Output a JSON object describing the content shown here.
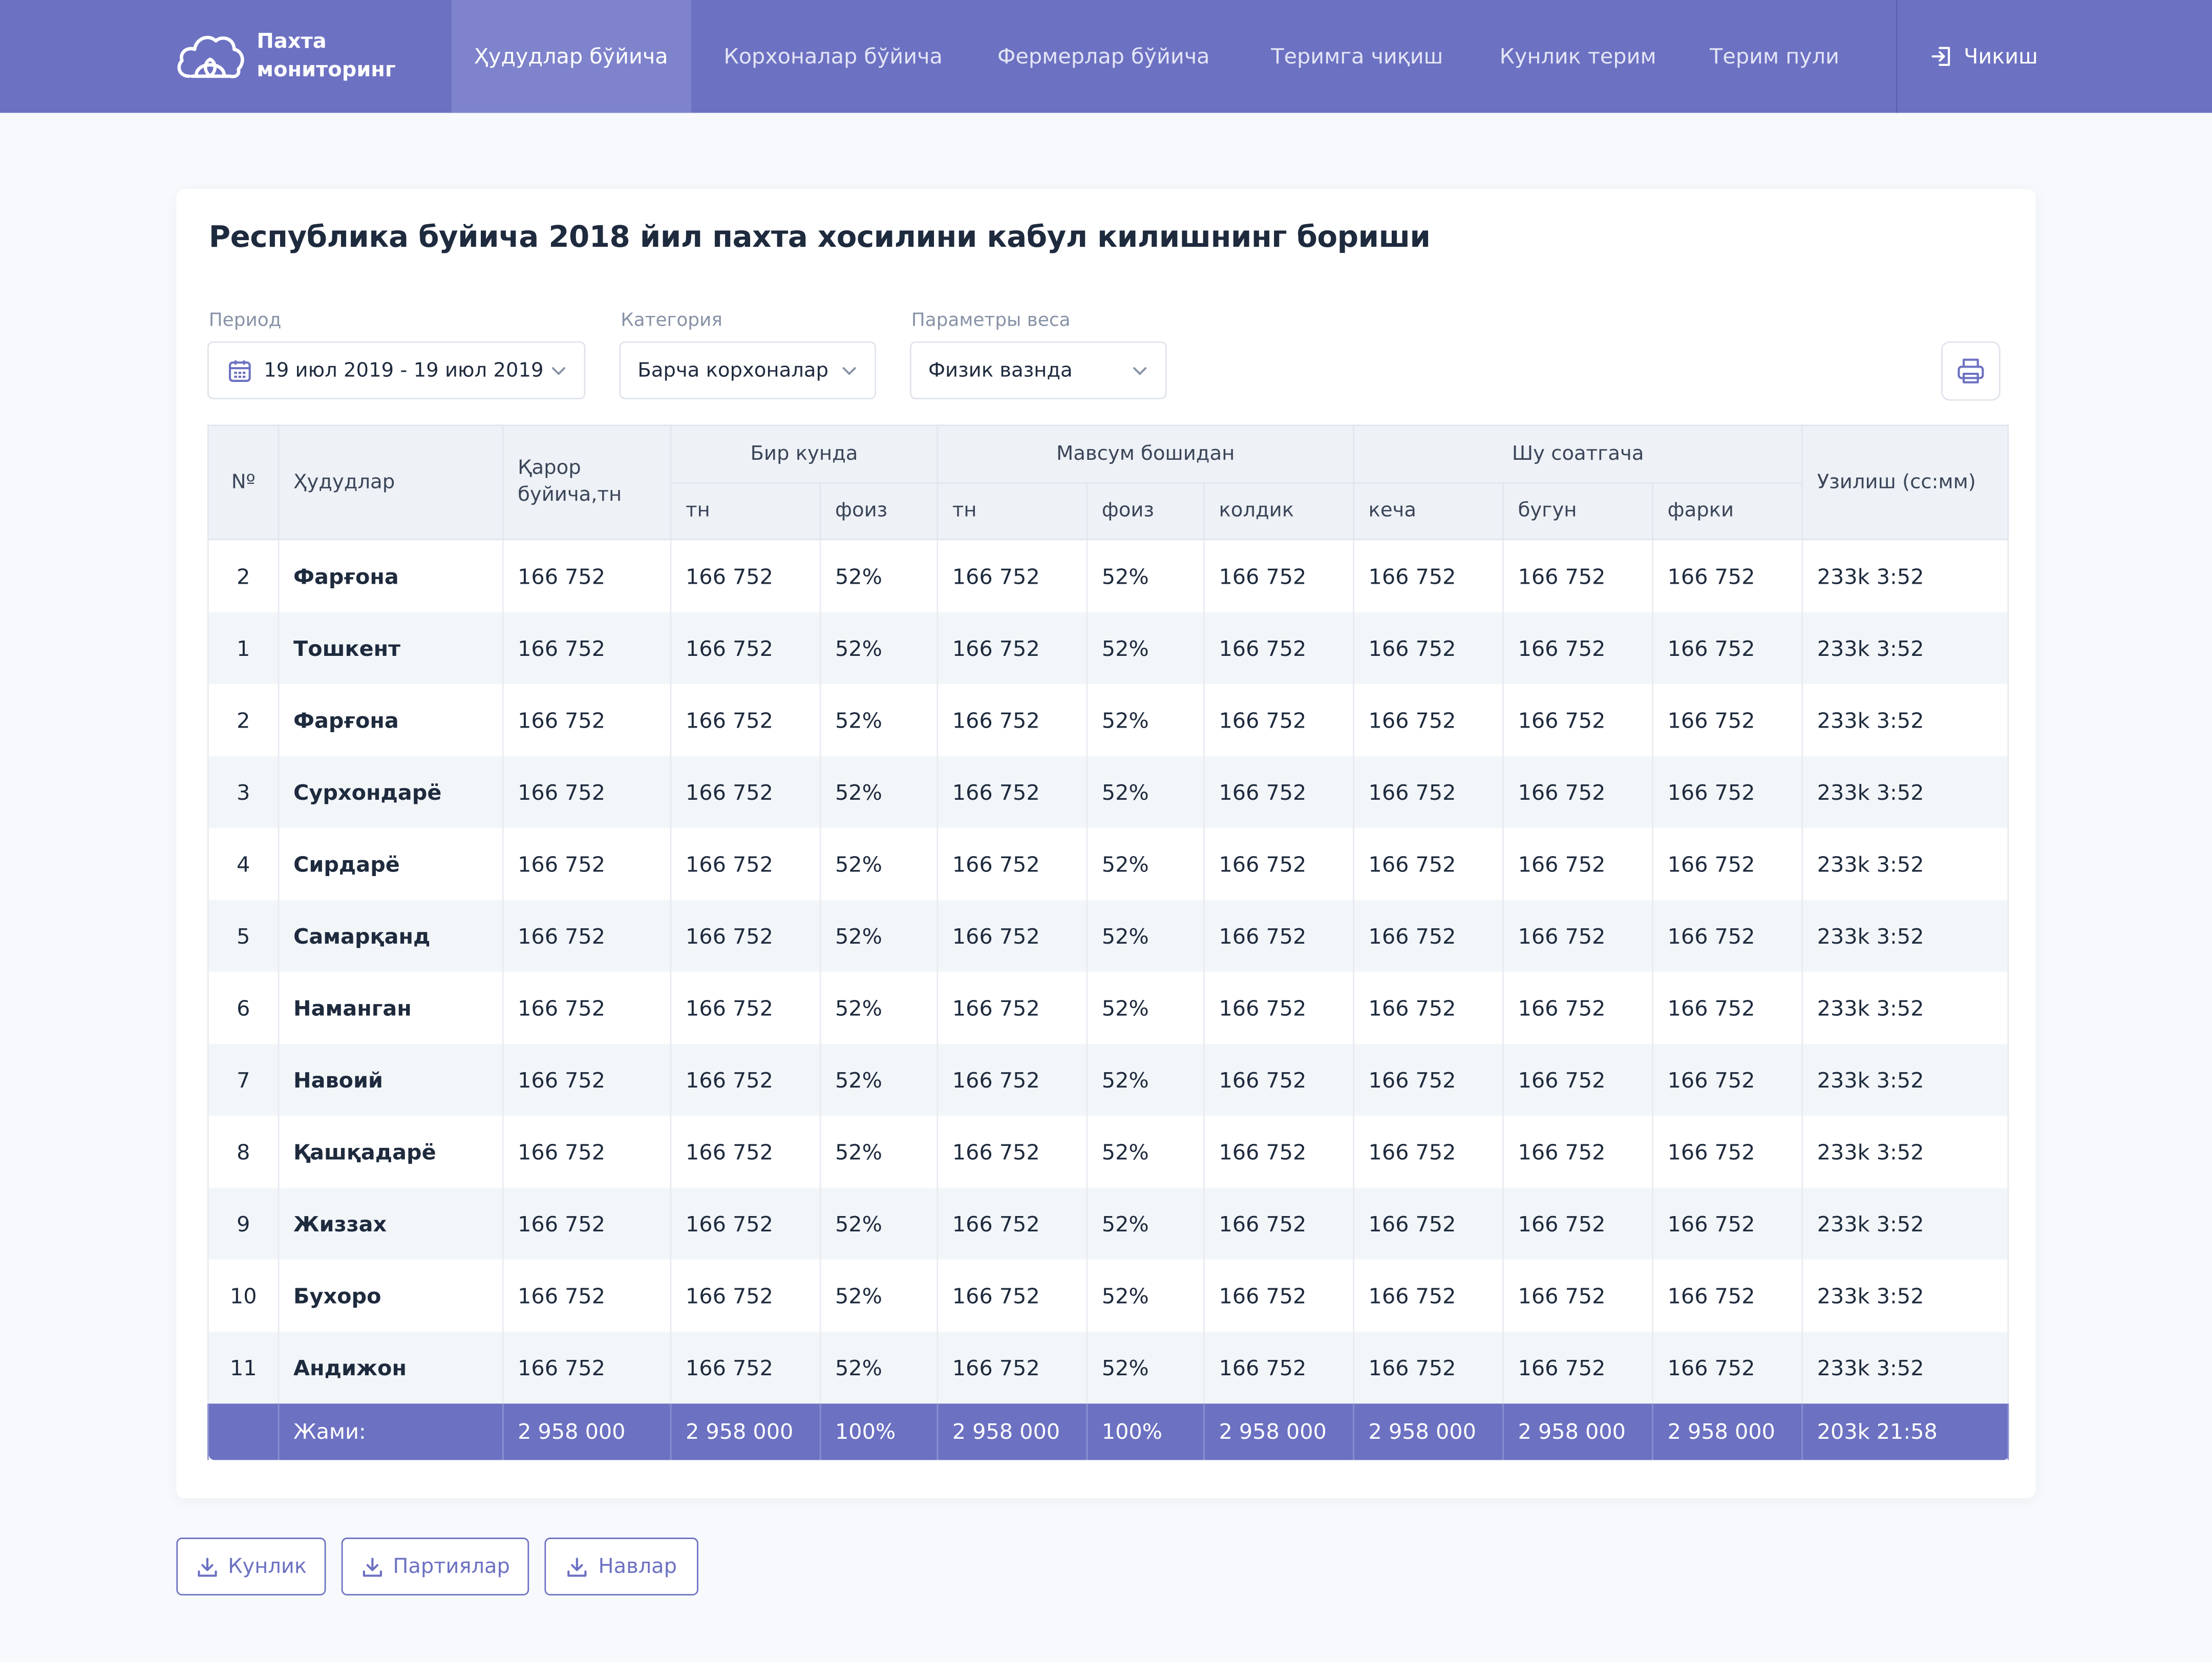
{
  "brand": {
    "line1": "Пахта",
    "line2": "мониторинг",
    "icon": "cotton-logo-icon"
  },
  "nav": {
    "items": [
      {
        "label": "Ҳудудлар бўйича",
        "active": true
      },
      {
        "label": "Корхоналар бўйича",
        "active": false
      },
      {
        "label": "Фермерлар бўйича",
        "active": false
      },
      {
        "label": "Теримга чиқиш",
        "active": false
      },
      {
        "label": "Кунлик терим",
        "active": false
      },
      {
        "label": "Терим пули",
        "active": false
      }
    ],
    "logout": "Чикиш"
  },
  "page": {
    "title": "Республика буйича 2018 йил пахта хосилини кабул килишнинг бориши"
  },
  "filters": {
    "period": {
      "label": "Период",
      "value": "19 июл 2019 - 19 июл 2019"
    },
    "category": {
      "label": "Категория",
      "value": "Барча корхоналар"
    },
    "weight": {
      "label": "Параметры веса",
      "value": "Физик вазнда"
    }
  },
  "table": {
    "headers": {
      "no": "Nº",
      "region": "Ҳудудлар",
      "plan": "Қарор буйича,тн",
      "day": "Бир кунда",
      "season": "Мавсум бошидан",
      "hour": "Шу соатгача",
      "gap": "Узилиш (cc:мм)",
      "day_tn": "тн",
      "day_pct": "фоиз",
      "season_tn": "тн",
      "season_pct": "фоиз",
      "season_rest": "колдик",
      "hour_yesterday": "кеча",
      "hour_today": "бугун",
      "hour_diff": "фарки"
    },
    "rows": [
      {
        "no": "2",
        "region": "Фарғона",
        "plan": "166 752",
        "day_tn": "166 752",
        "day_pct": "52%",
        "season_tn": "166 752",
        "season_pct": "52%",
        "season_rest": "166 752",
        "yesterday": "166 752",
        "today": "166 752",
        "diff": "166 752",
        "gap": "233k 3:52"
      },
      {
        "no": "1",
        "region": "Тошкент",
        "plan": "166 752",
        "day_tn": "166 752",
        "day_pct": "52%",
        "season_tn": "166 752",
        "season_pct": "52%",
        "season_rest": "166 752",
        "yesterday": "166 752",
        "today": "166 752",
        "diff": "166 752",
        "gap": "233k 3:52"
      },
      {
        "no": "2",
        "region": "Фарғона",
        "plan": "166 752",
        "day_tn": "166 752",
        "day_pct": "52%",
        "season_tn": "166 752",
        "season_pct": "52%",
        "season_rest": "166 752",
        "yesterday": "166 752",
        "today": "166 752",
        "diff": "166 752",
        "gap": "233k 3:52"
      },
      {
        "no": "3",
        "region": "Сурхондарё",
        "plan": "166 752",
        "day_tn": "166 752",
        "day_pct": "52%",
        "season_tn": "166 752",
        "season_pct": "52%",
        "season_rest": "166 752",
        "yesterday": "166 752",
        "today": "166 752",
        "diff": "166 752",
        "gap": "233k 3:52"
      },
      {
        "no": "4",
        "region": "Сирдарё",
        "plan": "166 752",
        "day_tn": "166 752",
        "day_pct": "52%",
        "season_tn": "166 752",
        "season_pct": "52%",
        "season_rest": "166 752",
        "yesterday": "166 752",
        "today": "166 752",
        "diff": "166 752",
        "gap": "233k 3:52"
      },
      {
        "no": "5",
        "region": "Самарқанд",
        "plan": "166 752",
        "day_tn": "166 752",
        "day_pct": "52%",
        "season_tn": "166 752",
        "season_pct": "52%",
        "season_rest": "166 752",
        "yesterday": "166 752",
        "today": "166 752",
        "diff": "166 752",
        "gap": "233k 3:52"
      },
      {
        "no": "6",
        "region": "Наманган",
        "plan": "166 752",
        "day_tn": "166 752",
        "day_pct": "52%",
        "season_tn": "166 752",
        "season_pct": "52%",
        "season_rest": "166 752",
        "yesterday": "166 752",
        "today": "166 752",
        "diff": "166 752",
        "gap": "233k 3:52"
      },
      {
        "no": "7",
        "region": "Навоий",
        "plan": "166 752",
        "day_tn": "166 752",
        "day_pct": "52%",
        "season_tn": "166 752",
        "season_pct": "52%",
        "season_rest": "166 752",
        "yesterday": "166 752",
        "today": "166 752",
        "diff": "166 752",
        "gap": "233k 3:52"
      },
      {
        "no": "8",
        "region": "Қашқадарё",
        "plan": "166 752",
        "day_tn": "166 752",
        "day_pct": "52%",
        "season_tn": "166 752",
        "season_pct": "52%",
        "season_rest": "166 752",
        "yesterday": "166 752",
        "today": "166 752",
        "diff": "166 752",
        "gap": "233k 3:52"
      },
      {
        "no": "9",
        "region": "Жиззах",
        "plan": "166 752",
        "day_tn": "166 752",
        "day_pct": "52%",
        "season_tn": "166 752",
        "season_pct": "52%",
        "season_rest": "166 752",
        "yesterday": "166 752",
        "today": "166 752",
        "diff": "166 752",
        "gap": "233k 3:52"
      },
      {
        "no": "10",
        "region": "Бухоро",
        "plan": "166 752",
        "day_tn": "166 752",
        "day_pct": "52%",
        "season_tn": "166 752",
        "season_pct": "52%",
        "season_rest": "166 752",
        "yesterday": "166 752",
        "today": "166 752",
        "diff": "166 752",
        "gap": "233k 3:52"
      },
      {
        "no": "11",
        "region": "Андижон",
        "plan": "166 752",
        "day_tn": "166 752",
        "day_pct": "52%",
        "season_tn": "166 752",
        "season_pct": "52%",
        "season_rest": "166 752",
        "yesterday": "166 752",
        "today": "166 752",
        "diff": "166 752",
        "gap": "233k 3:52"
      }
    ],
    "total": {
      "label": "Жами:",
      "plan": "2 958 000",
      "day_tn": "2 958 000",
      "day_pct": "100%",
      "season_tn": "2 958 000",
      "season_pct": "100%",
      "season_rest": "2 958 000",
      "yesterday": "2 958 000",
      "today": "2 958 000",
      "diff": "2 958 000",
      "gap": "203k 21:58"
    }
  },
  "downloads": [
    {
      "label": "Кунлик",
      "icon": "download-icon"
    },
    {
      "label": "Партиялар",
      "icon": "download-icon"
    },
    {
      "label": "Навлар",
      "icon": "download-icon"
    }
  ],
  "colors": {
    "primary": "#6c71c2",
    "nav_active": "#7e83cc",
    "background": "#f7f9fc",
    "text": "#1e2a3d"
  }
}
